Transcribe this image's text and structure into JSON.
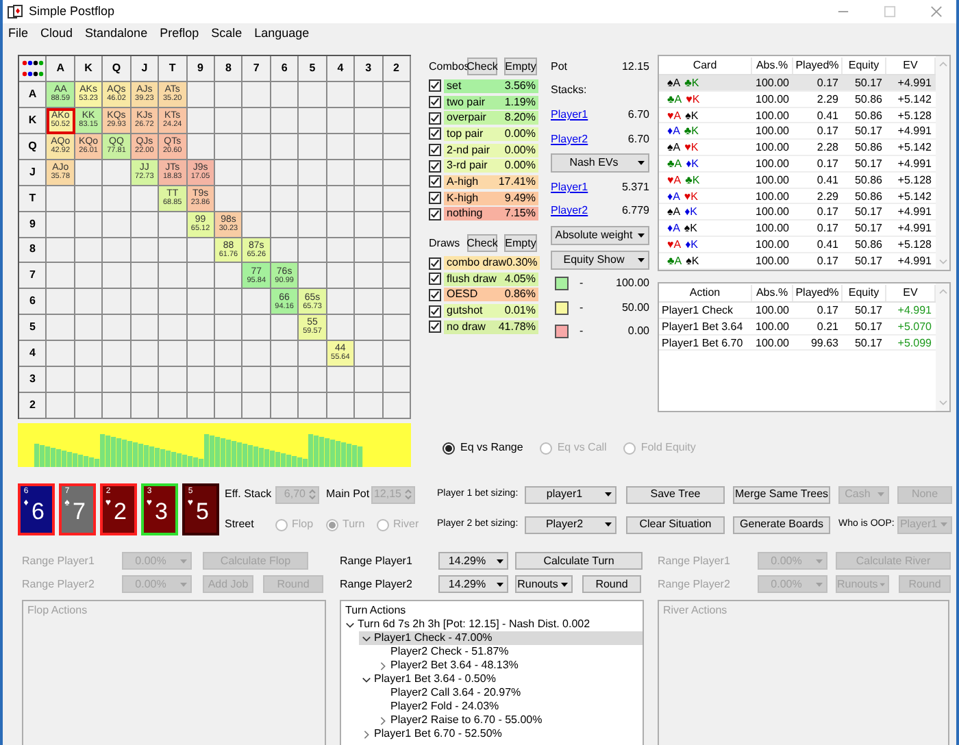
{
  "window": {
    "title": "Simple Postflop"
  },
  "menu": [
    "File",
    "Cloud",
    "Standalone",
    "Preflop",
    "Scale",
    "Language"
  ],
  "hand_grid": {
    "columns": [
      "A",
      "K",
      "Q",
      "J",
      "T",
      "9",
      "8",
      "7",
      "6",
      "5",
      "4",
      "3",
      "2"
    ],
    "rows": [
      {
        "label": "A",
        "cells": [
          {
            "hand": "AA",
            "value": "88.59",
            "color": "#b4f0a0",
            "selected": false
          },
          {
            "hand": "AKs",
            "value": "53.23",
            "color": "#f8f4a4",
            "selected": false
          },
          {
            "hand": "AQs",
            "value": "46.02",
            "color": "#f8e8a4",
            "selected": false
          },
          {
            "hand": "AJs",
            "value": "39.23",
            "color": "#f8dca4",
            "selected": false
          },
          {
            "hand": "ATs",
            "value": "35.20",
            "color": "#f8d8a4",
            "selected": false
          },
          null,
          null,
          null,
          null,
          null,
          null,
          null,
          null
        ]
      },
      {
        "label": "K",
        "cells": [
          {
            "hand": "AKo",
            "value": "50.52",
            "color": "#f8f0a4",
            "selected": true
          },
          {
            "hand": "KK",
            "value": "83.15",
            "color": "#bcf0a0",
            "selected": false
          },
          {
            "hand": "KQs",
            "value": "29.93",
            "color": "#f8cca4",
            "selected": false
          },
          {
            "hand": "KJs",
            "value": "26.72",
            "color": "#f8c8a4",
            "selected": false
          },
          {
            "hand": "KTs",
            "value": "24.24",
            "color": "#f8c4a4",
            "selected": false
          },
          null,
          null,
          null,
          null,
          null,
          null,
          null,
          null
        ]
      },
      {
        "label": "Q",
        "cells": [
          {
            "hand": "AQo",
            "value": "42.92",
            "color": "#f8e4a4",
            "selected": false
          },
          {
            "hand": "KQo",
            "value": "26.01",
            "color": "#f8c8a4",
            "selected": false
          },
          {
            "hand": "QQ",
            "value": "77.81",
            "color": "#c8f0a0",
            "selected": false
          },
          {
            "hand": "QJs",
            "value": "22.00",
            "color": "#f8c0a4",
            "selected": false
          },
          {
            "hand": "QTs",
            "value": "20.60",
            "color": "#f8bca4",
            "selected": false
          },
          null,
          null,
          null,
          null,
          null,
          null,
          null,
          null
        ]
      },
      {
        "label": "J",
        "cells": [
          {
            "hand": "AJo",
            "value": "35.78",
            "color": "#f8d8a4",
            "selected": false
          },
          null,
          null,
          {
            "hand": "JJ",
            "value": "72.73",
            "color": "#d4f4a0",
            "selected": false
          },
          {
            "hand": "JTs",
            "value": "18.83",
            "color": "#f4b8a4",
            "selected": false
          },
          {
            "hand": "J9s",
            "value": "17.05",
            "color": "#f4b4a4",
            "selected": false
          },
          null,
          null,
          null,
          null,
          null,
          null,
          null
        ]
      },
      {
        "label": "T",
        "cells": [
          null,
          null,
          null,
          null,
          {
            "hand": "TT",
            "value": "68.85",
            "color": "#dcf4a0",
            "selected": false
          },
          {
            "hand": "T9s",
            "value": "23.86",
            "color": "#f8c4a4",
            "selected": false
          },
          null,
          null,
          null,
          null,
          null,
          null,
          null
        ]
      },
      {
        "label": "9",
        "cells": [
          null,
          null,
          null,
          null,
          null,
          {
            "hand": "99",
            "value": "65.12",
            "color": "#e4f8a0",
            "selected": false
          },
          {
            "hand": "98s",
            "value": "30.23",
            "color": "#f8cca4",
            "selected": false
          },
          null,
          null,
          null,
          null,
          null,
          null
        ]
      },
      {
        "label": "8",
        "cells": [
          null,
          null,
          null,
          null,
          null,
          null,
          {
            "hand": "88",
            "value": "61.76",
            "color": "#e8f8a0",
            "selected": false
          },
          {
            "hand": "87s",
            "value": "65.26",
            "color": "#e4f8a0",
            "selected": false
          },
          null,
          null,
          null,
          null,
          null
        ]
      },
      {
        "label": "7",
        "cells": [
          null,
          null,
          null,
          null,
          null,
          null,
          null,
          {
            "hand": "77",
            "value": "95.84",
            "color": "#a4f09c",
            "selected": false
          },
          {
            "hand": "76s",
            "value": "90.99",
            "color": "#acf09c",
            "selected": false
          },
          null,
          null,
          null,
          null
        ]
      },
      {
        "label": "6",
        "cells": [
          null,
          null,
          null,
          null,
          null,
          null,
          null,
          null,
          {
            "hand": "66",
            "value": "94.16",
            "color": "#a8f09c",
            "selected": false
          },
          {
            "hand": "65s",
            "value": "65.73",
            "color": "#e4f8a0",
            "selected": false
          },
          null,
          null,
          null
        ]
      },
      {
        "label": "5",
        "cells": [
          null,
          null,
          null,
          null,
          null,
          null,
          null,
          null,
          null,
          {
            "hand": "55",
            "value": "59.57",
            "color": "#ecf8a0",
            "selected": false
          },
          null,
          null,
          null
        ]
      },
      {
        "label": "4",
        "cells": [
          null,
          null,
          null,
          null,
          null,
          null,
          null,
          null,
          null,
          null,
          {
            "hand": "44",
            "value": "55.64",
            "color": "#f4f8a0",
            "selected": false
          },
          null,
          null
        ]
      },
      {
        "label": "3",
        "cells": [
          null,
          null,
          null,
          null,
          null,
          null,
          null,
          null,
          null,
          null,
          null,
          null,
          null
        ]
      },
      {
        "label": "2",
        "cells": [
          null,
          null,
          null,
          null,
          null,
          null,
          null,
          null,
          null,
          null,
          null,
          null,
          null
        ]
      }
    ]
  },
  "combos": {
    "title": "Combos",
    "buttons": [
      "Check",
      "Empty"
    ],
    "items": [
      {
        "label": "set",
        "checked": true,
        "value": "3.56%",
        "color": "#a8f0a0"
      },
      {
        "label": "two pair",
        "checked": true,
        "value": "1.19%",
        "color": "#b0f0a0"
      },
      {
        "label": "overpair",
        "checked": true,
        "value": "8.20%",
        "color": "#c4f4a4"
      },
      {
        "label": "top pair",
        "checked": true,
        "value": "0.00%",
        "color": "#e4f8b0"
      },
      {
        "label": "2-nd pair",
        "checked": true,
        "value": "0.00%",
        "color": "#e8f8b0"
      },
      {
        "label": "3-rd pair",
        "checked": true,
        "value": "0.00%",
        "color": "#e8f8b0"
      },
      {
        "label": "A-high",
        "checked": true,
        "value": "17.41%",
        "color": "#fcd8a8"
      },
      {
        "label": "K-high",
        "checked": true,
        "value": "9.49%",
        "color": "#fcc8a0"
      },
      {
        "label": "nothing",
        "checked": true,
        "value": "7.15%",
        "color": "#f8b0a0"
      }
    ]
  },
  "draws": {
    "title": "Draws",
    "buttons": [
      "Check",
      "Empty"
    ],
    "items": [
      {
        "label": "combo draw",
        "checked": true,
        "value": "0.30%",
        "color": "#fce4a8"
      },
      {
        "label": "flush draw",
        "checked": true,
        "value": "4.05%",
        "color": "#d8f4a8"
      },
      {
        "label": "OESD",
        "checked": true,
        "value": "0.86%",
        "color": "#fcc8a0"
      },
      {
        "label": "gutshot",
        "checked": true,
        "value": "0.01%",
        "color": "#e4f8b0"
      },
      {
        "label": "no draw",
        "checked": true,
        "value": "41.78%",
        "color": "#d8f0a8"
      }
    ]
  },
  "pot": {
    "label": "Pot",
    "value": "12.15",
    "stacks_label": "Stacks:",
    "stacks": [
      {
        "player": "Player1",
        "value": "6.70"
      },
      {
        "player": "Player2",
        "value": "6.70"
      }
    ],
    "ev_mode": "Nash EVs",
    "evs": [
      {
        "player": "Player1",
        "value": "5.371"
      },
      {
        "player": "Player2",
        "value": "6.779"
      }
    ],
    "weight_mode": "Absolute weight",
    "equity_mode": "Equity Show",
    "legend": [
      {
        "color": "#a8f0a0",
        "dash": "-",
        "value": "100.00"
      },
      {
        "color": "#f8f8a0",
        "dash": "-",
        "value": "50.00"
      },
      {
        "color": "#f8a8a8",
        "dash": "-",
        "value": "0.00"
      }
    ]
  },
  "card_table": {
    "columns": [
      "Card",
      "Abs.%",
      "Played%",
      "Equity",
      "EV"
    ],
    "rows": [
      {
        "cards": [
          {
            "text": "♠A",
            "color": "#000000"
          },
          {
            "text": "♣K",
            "color": "#008000"
          }
        ],
        "abs": "100.00",
        "played": "0.17",
        "equity": "50.17",
        "ev": "+4.991",
        "selected": true
      },
      {
        "cards": [
          {
            "text": "♣A",
            "color": "#008000"
          },
          {
            "text": "♥K",
            "color": "#e00000"
          }
        ],
        "abs": "100.00",
        "played": "2.29",
        "equity": "50.86",
        "ev": "+5.142",
        "selected": false
      },
      {
        "cards": [
          {
            "text": "♥A",
            "color": "#e00000"
          },
          {
            "text": "♠K",
            "color": "#000000"
          }
        ],
        "abs": "100.00",
        "played": "0.41",
        "equity": "50.86",
        "ev": "+5.128",
        "selected": false
      },
      {
        "cards": [
          {
            "text": "♦A",
            "color": "#0000e0"
          },
          {
            "text": "♣K",
            "color": "#008000"
          }
        ],
        "abs": "100.00",
        "played": "0.17",
        "equity": "50.17",
        "ev": "+4.991",
        "selected": false
      },
      {
        "cards": [
          {
            "text": "♠A",
            "color": "#000000"
          },
          {
            "text": "♥K",
            "color": "#e00000"
          }
        ],
        "abs": "100.00",
        "played": "2.28",
        "equity": "50.86",
        "ev": "+5.142",
        "selected": false
      },
      {
        "cards": [
          {
            "text": "♣A",
            "color": "#008000"
          },
          {
            "text": "♦K",
            "color": "#0000e0"
          }
        ],
        "abs": "100.00",
        "played": "0.17",
        "equity": "50.17",
        "ev": "+4.991",
        "selected": false
      },
      {
        "cards": [
          {
            "text": "♥A",
            "color": "#e00000"
          },
          {
            "text": "♣K",
            "color": "#008000"
          }
        ],
        "abs": "100.00",
        "played": "0.41",
        "equity": "50.86",
        "ev": "+5.128",
        "selected": false
      },
      {
        "cards": [
          {
            "text": "♦A",
            "color": "#0000e0"
          },
          {
            "text": "♥K",
            "color": "#e00000"
          }
        ],
        "abs": "100.00",
        "played": "2.29",
        "equity": "50.86",
        "ev": "+5.142",
        "selected": false
      },
      {
        "cards": [
          {
            "text": "♠A",
            "color": "#000000"
          },
          {
            "text": "♦K",
            "color": "#0000e0"
          }
        ],
        "abs": "100.00",
        "played": "0.17",
        "equity": "50.17",
        "ev": "+4.991",
        "selected": false
      },
      {
        "cards": [
          {
            "text": "♦A",
            "color": "#0000e0"
          },
          {
            "text": "♠K",
            "color": "#000000"
          }
        ],
        "abs": "100.00",
        "played": "0.17",
        "equity": "50.17",
        "ev": "+4.991",
        "selected": false
      },
      {
        "cards": [
          {
            "text": "♥A",
            "color": "#e00000"
          },
          {
            "text": "♦K",
            "color": "#0000e0"
          }
        ],
        "abs": "100.00",
        "played": "0.41",
        "equity": "50.86",
        "ev": "+5.128",
        "selected": false
      },
      {
        "cards": [
          {
            "text": "♣A",
            "color": "#008000"
          },
          {
            "text": "♠K",
            "color": "#000000"
          }
        ],
        "abs": "100.00",
        "played": "0.17",
        "equity": "50.17",
        "ev": "+4.991",
        "selected": false
      }
    ]
  },
  "action_table": {
    "columns": [
      "Action",
      "Abs.%",
      "Played%",
      "Equity",
      "EV"
    ],
    "rows": [
      {
        "action": "Player1 Check",
        "abs": "100.00",
        "played": "0.17",
        "equity": "50.17",
        "ev": "+4.991"
      },
      {
        "action": "Player1 Bet 3.64",
        "abs": "100.00",
        "played": "0.21",
        "equity": "50.17",
        "ev": "+5.070"
      },
      {
        "action": "Player1 Bet 6.70",
        "abs": "100.00",
        "played": "99.63",
        "equity": "50.17",
        "ev": "+5.099"
      }
    ]
  },
  "equity_modes": [
    {
      "label": "Eq vs Range",
      "selected": true,
      "disabled": false
    },
    {
      "label": "Eq vs Call",
      "selected": false,
      "disabled": true
    },
    {
      "label": "Fold Equity",
      "selected": false,
      "disabled": true
    }
  ],
  "board": [
    {
      "corner": "6",
      "suit": "♦",
      "rank": "6",
      "color": "#0c0c82",
      "marked": true,
      "selected": false
    },
    {
      "corner": "7",
      "suit": "♠",
      "rank": "7",
      "color": "#6e6e6e",
      "marked": true,
      "selected": false
    },
    {
      "corner": "2",
      "suit": "♥",
      "rank": "2",
      "color": "#780404",
      "marked": true,
      "selected": false
    },
    {
      "corner": "3",
      "suit": "♥",
      "rank": "3",
      "color": "#780404",
      "marked": false,
      "selected": true
    },
    {
      "corner": "5",
      "suit": "♥",
      "rank": "5",
      "color": "#680404",
      "marked": false,
      "selected": false
    }
  ],
  "eff_stack": {
    "label": "Eff. Stack",
    "value": "6,70",
    "disabled": true
  },
  "main_pot": {
    "label": "Main Pot",
    "value": "12,15",
    "disabled": true
  },
  "street": {
    "label": "Street",
    "options": [
      {
        "label": "Flop",
        "selected": false,
        "disabled": true
      },
      {
        "label": "Turn",
        "selected": true,
        "disabled": true
      },
      {
        "label": "River",
        "selected": false,
        "disabled": true
      }
    ]
  },
  "bet_sizing": [
    {
      "label": "Player 1 bet sizing:",
      "value": "player1"
    },
    {
      "label": "Player 2 bet sizing:",
      "value": "Player2"
    }
  ],
  "buttons": [
    {
      "label": "Save Tree",
      "disabled": false
    },
    {
      "label": "Merge Same Trees",
      "disabled": false
    },
    {
      "label": "Clear Situation",
      "disabled": false
    },
    {
      "label": "Generate Boards",
      "disabled": false
    }
  ],
  "game_type": {
    "value": "Cash",
    "disabled": true
  },
  "none_button": {
    "label": "None",
    "disabled": true
  },
  "oop": {
    "label": "Who is OOP:",
    "value": "Player1",
    "disabled": true
  },
  "ranges": [
    {
      "disabled": true,
      "rows": [
        {
          "label": "Range Player1",
          "value": "0.00%",
          "controls": [
            {
              "kind": "button",
              "label": "Calculate Flop"
            }
          ]
        },
        {
          "label": "Range Player2",
          "value": "0.00%",
          "controls": [
            {
              "kind": "button",
              "label": "Add Job"
            },
            {
              "kind": "button",
              "label": "Round"
            }
          ]
        }
      ]
    },
    {
      "disabled": false,
      "rows": [
        {
          "label": "Range Player1",
          "value": "14.29%",
          "controls": [
            {
              "kind": "button",
              "label": "Calculate Turn"
            }
          ]
        },
        {
          "label": "Range Player2",
          "value": "14.29%",
          "controls": [
            {
              "kind": "dropdown",
              "label": "Runouts"
            },
            {
              "kind": "button",
              "label": "Round"
            }
          ]
        }
      ]
    },
    {
      "disabled": true,
      "rows": [
        {
          "label": "Range Player1",
          "value": "0.00%",
          "controls": [
            {
              "kind": "button",
              "label": "Calculate River"
            }
          ]
        },
        {
          "label": "Range Player2",
          "value": "0.00%",
          "controls": [
            {
              "kind": "dropdown",
              "label": "Runouts"
            },
            {
              "kind": "button",
              "label": "Round"
            }
          ]
        }
      ]
    }
  ],
  "action_panels": [
    {
      "title": "Flop Actions",
      "disabled": true
    },
    {
      "title": "Turn Actions",
      "disabled": false,
      "tree": [
        {
          "label": "Turn 6d 7s 2h 3h [Pot: 12.15] - Nash Dist. 0.002",
          "expanded": true,
          "selected": false,
          "children": [
            {
              "label": "Player1 Check - 47.00%",
              "expanded": true,
              "selected": true,
              "children": [
                {
                  "label": "Player2 Check - 51.87%",
                  "selected": false
                },
                {
                  "label": "Player2 Bet 3.64 - 48.13%",
                  "expanded": false,
                  "selected": false
                }
              ]
            },
            {
              "label": "Player1 Bet 3.64 - 0.50%",
              "expanded": true,
              "selected": false,
              "children": [
                {
                  "label": "Player2 Call 3.64 - 20.97%",
                  "selected": false
                },
                {
                  "label": "Player2 Fold - 24.03%",
                  "selected": false
                },
                {
                  "label": "Player2 Raise to 6.70 - 55.00%",
                  "expanded": false,
                  "selected": false
                }
              ]
            },
            {
              "label": "Player1 Bet 6.70 - 52.50%",
              "expanded": false,
              "selected": false
            }
          ]
        }
      ]
    },
    {
      "title": "River Actions",
      "disabled": true
    }
  ]
}
